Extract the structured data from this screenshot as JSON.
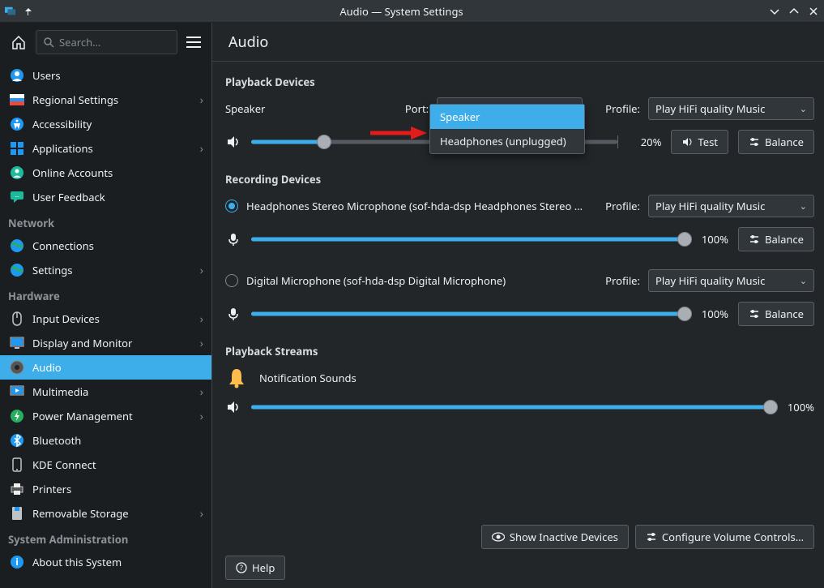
{
  "window": {
    "title": "Audio — System Settings"
  },
  "toolbar": {
    "search_placeholder": "Search…"
  },
  "sidebar": {
    "items": [
      {
        "label": "Users",
        "icon": "users-icon",
        "expandable": false
      },
      {
        "label": "Regional Settings",
        "icon": "locale-icon",
        "expandable": true
      },
      {
        "label": "Accessibility",
        "icon": "accessibility-icon",
        "expandable": false
      },
      {
        "label": "Applications",
        "icon": "applications-icon",
        "expandable": true
      },
      {
        "label": "Online Accounts",
        "icon": "online-accounts-icon",
        "expandable": false
      },
      {
        "label": "User Feedback",
        "icon": "feedback-icon",
        "expandable": false
      }
    ],
    "groups": [
      {
        "title": "Network",
        "items": [
          {
            "label": "Connections",
            "icon": "globe-icon",
            "expandable": false
          },
          {
            "label": "Settings",
            "icon": "globe-icon",
            "expandable": true
          }
        ]
      },
      {
        "title": "Hardware",
        "items": [
          {
            "label": "Input Devices",
            "icon": "mouse-icon",
            "expandable": true
          },
          {
            "label": "Display and Monitor",
            "icon": "monitor-icon",
            "expandable": true
          },
          {
            "label": "Audio",
            "icon": "audio-icon",
            "expandable": false,
            "selected": true
          },
          {
            "label": "Multimedia",
            "icon": "multimedia-icon",
            "expandable": true
          },
          {
            "label": "Power Management",
            "icon": "battery-icon",
            "expandable": true
          },
          {
            "label": "Bluetooth",
            "icon": "bluetooth-icon",
            "expandable": false
          },
          {
            "label": "KDE Connect",
            "icon": "kdeconnect-icon",
            "expandable": false
          },
          {
            "label": "Printers",
            "icon": "printer-icon",
            "expandable": false
          },
          {
            "label": "Removable Storage",
            "icon": "removable-icon",
            "expandable": true
          }
        ]
      },
      {
        "title": "System Administration",
        "items": [
          {
            "label": "About this System",
            "icon": "info-icon",
            "expandable": false
          }
        ]
      }
    ]
  },
  "page": {
    "title": "Audio",
    "playback_devices": {
      "title": "Playback Devices",
      "device_name": "Speaker",
      "port_label": "Port:",
      "port_value": "Speaker",
      "port_options": [
        "Speaker",
        "Headphones (unplugged)"
      ],
      "profile_label": "Profile:",
      "profile_value": "Play HiFi quality Music",
      "volume_pct": "20%",
      "volume_decimal": 0.2,
      "test_label": "Test",
      "balance_label": "Balance"
    },
    "recording_devices": {
      "title": "Recording Devices",
      "profile_label": "Profile:",
      "balance_label": "Balance",
      "devices": [
        {
          "name": "Headphones Stereo Microphone (sof-hda-dsp Headphones Stereo …",
          "selected": true,
          "profile_value": "Play HiFi quality Music",
          "volume_pct": "100%",
          "volume_decimal": 1.0
        },
        {
          "name": "Digital Microphone (sof-hda-dsp Digital Microphone)",
          "selected": false,
          "profile_value": "Play HiFi quality Music",
          "volume_pct": "100%",
          "volume_decimal": 1.0
        }
      ]
    },
    "playback_streams": {
      "title": "Playback Streams",
      "stream_name": "Notification Sounds",
      "volume_pct": "100%",
      "volume_decimal": 1.0
    },
    "footer": {
      "show_inactive": "Show Inactive Devices",
      "configure": "Configure Volume Controls…",
      "help": "Help"
    }
  }
}
